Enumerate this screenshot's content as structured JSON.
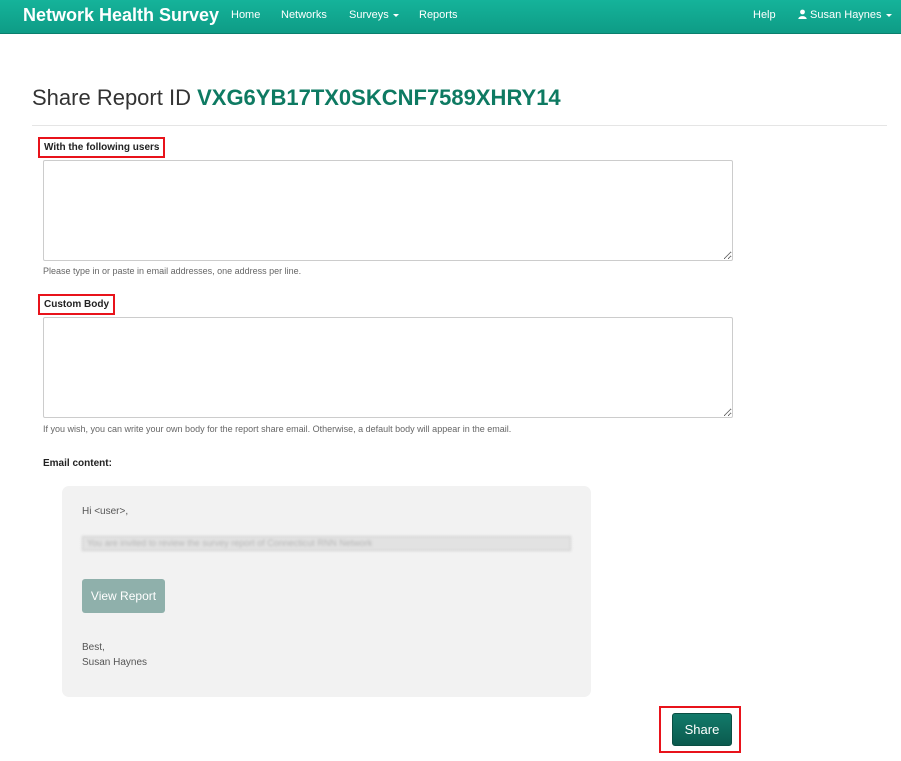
{
  "navbar": {
    "brand": "Network Health Survey",
    "items": [
      "Home",
      "Networks",
      "Surveys",
      "Reports"
    ],
    "help": "Help",
    "user": "Susan Haynes"
  },
  "page": {
    "title_prefix": "Share Report ID",
    "report_id": "VXG6YB17TX0SKCNF7589XHRY14"
  },
  "form": {
    "users_label": "With the following users",
    "users_value": "",
    "users_help": "Please type in or paste in email addresses, one address per line.",
    "body_label": "Custom Body",
    "body_value": "",
    "body_help": "If you wish, you can write your own body for the report share email. Otherwise, a default body will appear in the email.",
    "email_content_label": "Email content:"
  },
  "email": {
    "greeting": "Hi <user>,",
    "blurred_line": "You are invited to review the survey report of Connecticut RNN Network",
    "view_report_label": "View Report",
    "signoff": "Best,",
    "sender": "Susan Haynes"
  },
  "actions": {
    "share_label": "Share"
  },
  "colors": {
    "navbar": "#13a990",
    "accent": "#0e7a62",
    "highlight": "#e8131b"
  }
}
